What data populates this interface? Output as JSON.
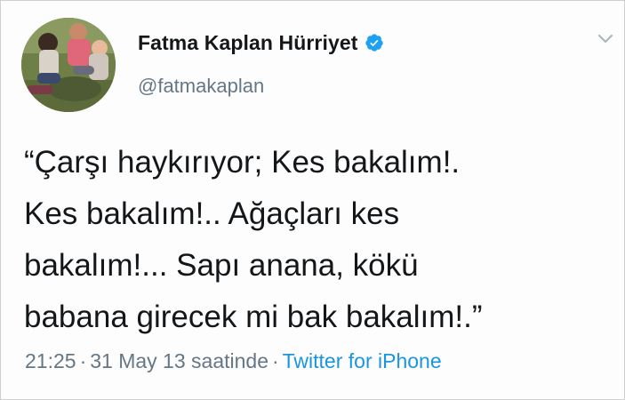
{
  "tweet": {
    "display_name": "Fatma Kaplan Hürriyet",
    "handle": "@fatmakaplan",
    "text": "“Çarşı haykırıyor; Kes bakalım!.\nKes bakalım!.. Ağaçları kes\nbakalım!... Sapı anana, kökü\nbabana girecek mi bak bakalım!.”",
    "time": "21:25",
    "separator": "·",
    "date": "31 May 13 saatinde",
    "source": "Twitter for iPhone"
  },
  "icons": {
    "verified": "verified-badge-icon",
    "menu": "chevron-down-icon"
  },
  "colors": {
    "text": "#14171a",
    "secondary": "#657786",
    "link": "#1b95e0",
    "verified": "#1da1f2"
  }
}
